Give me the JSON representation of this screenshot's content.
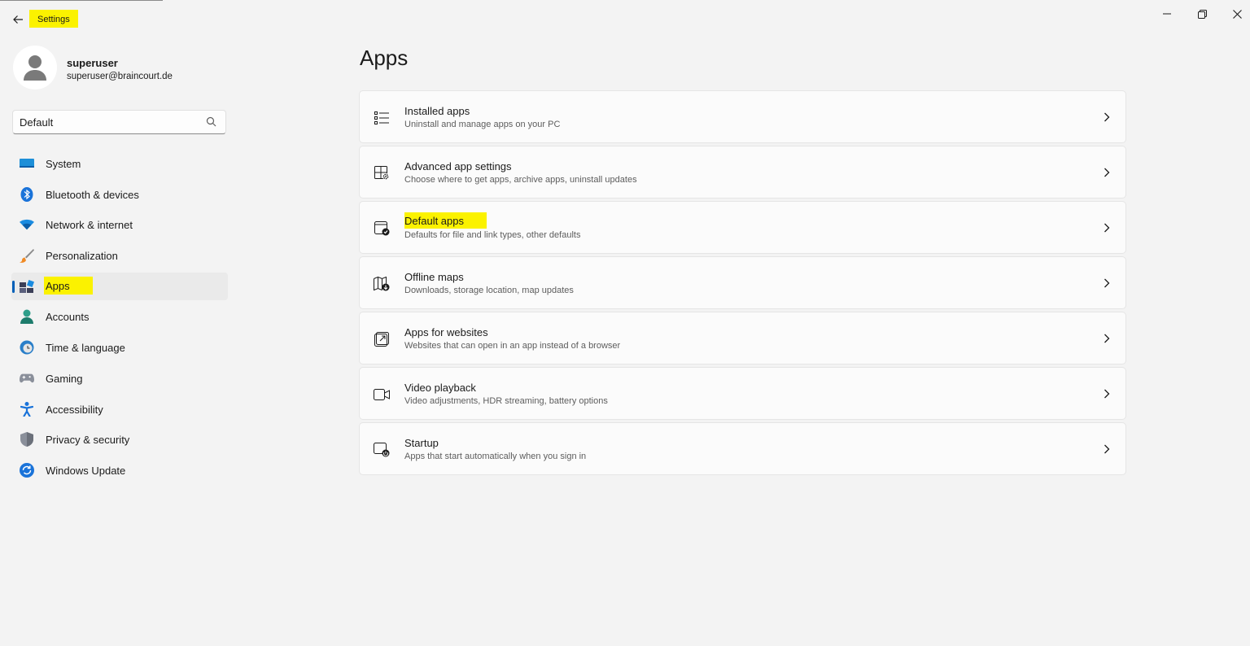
{
  "window": {
    "title": "Settings",
    "controls": [
      "minimize-icon",
      "restore-icon",
      "close-icon"
    ]
  },
  "profile": {
    "name": "superuser",
    "email": "superuser@braincourt.de"
  },
  "search": {
    "value": "Default",
    "icon": "search-icon"
  },
  "sidebar": {
    "items": [
      {
        "label": "System",
        "icon": "system-icon",
        "active": false
      },
      {
        "label": "Bluetooth & devices",
        "icon": "bluetooth-icon",
        "active": false
      },
      {
        "label": "Network & internet",
        "icon": "wifi-icon",
        "active": false
      },
      {
        "label": "Personalization",
        "icon": "brush-icon",
        "active": false
      },
      {
        "label": "Apps",
        "icon": "apps-icon",
        "active": true
      },
      {
        "label": "Accounts",
        "icon": "accounts-icon",
        "active": false
      },
      {
        "label": "Time & language",
        "icon": "globe-clock-icon",
        "active": false
      },
      {
        "label": "Gaming",
        "icon": "gamepad-icon",
        "active": false
      },
      {
        "label": "Accessibility",
        "icon": "accessibility-icon",
        "active": false
      },
      {
        "label": "Privacy & security",
        "icon": "shield-icon",
        "active": false
      },
      {
        "label": "Windows Update",
        "icon": "update-icon",
        "active": false
      }
    ]
  },
  "main": {
    "title": "Apps",
    "cards": [
      {
        "title": "Installed apps",
        "subtitle": "Uninstall and manage apps on your PC",
        "icon": "list-icon"
      },
      {
        "title": "Advanced app settings",
        "subtitle": "Choose where to get apps, archive apps, uninstall updates",
        "icon": "app-settings-icon"
      },
      {
        "title": "Default apps",
        "subtitle": "Defaults for file and link types, other defaults",
        "icon": "default-apps-icon"
      },
      {
        "title": "Offline maps",
        "subtitle": "Downloads, storage location, map updates",
        "icon": "map-download-icon"
      },
      {
        "title": "Apps for websites",
        "subtitle": "Websites that can open in an app instead of a browser",
        "icon": "open-in-app-icon"
      },
      {
        "title": "Video playback",
        "subtitle": "Video adjustments, HDR streaming, battery options",
        "icon": "video-icon"
      },
      {
        "title": "Startup",
        "subtitle": "Apps that start automatically when you sign in",
        "icon": "startup-icon"
      }
    ]
  },
  "colors": {
    "accent": "#005fb8",
    "highlight": "#fbf200",
    "background": "#f3f3f3",
    "card": "#fbfbfb"
  }
}
